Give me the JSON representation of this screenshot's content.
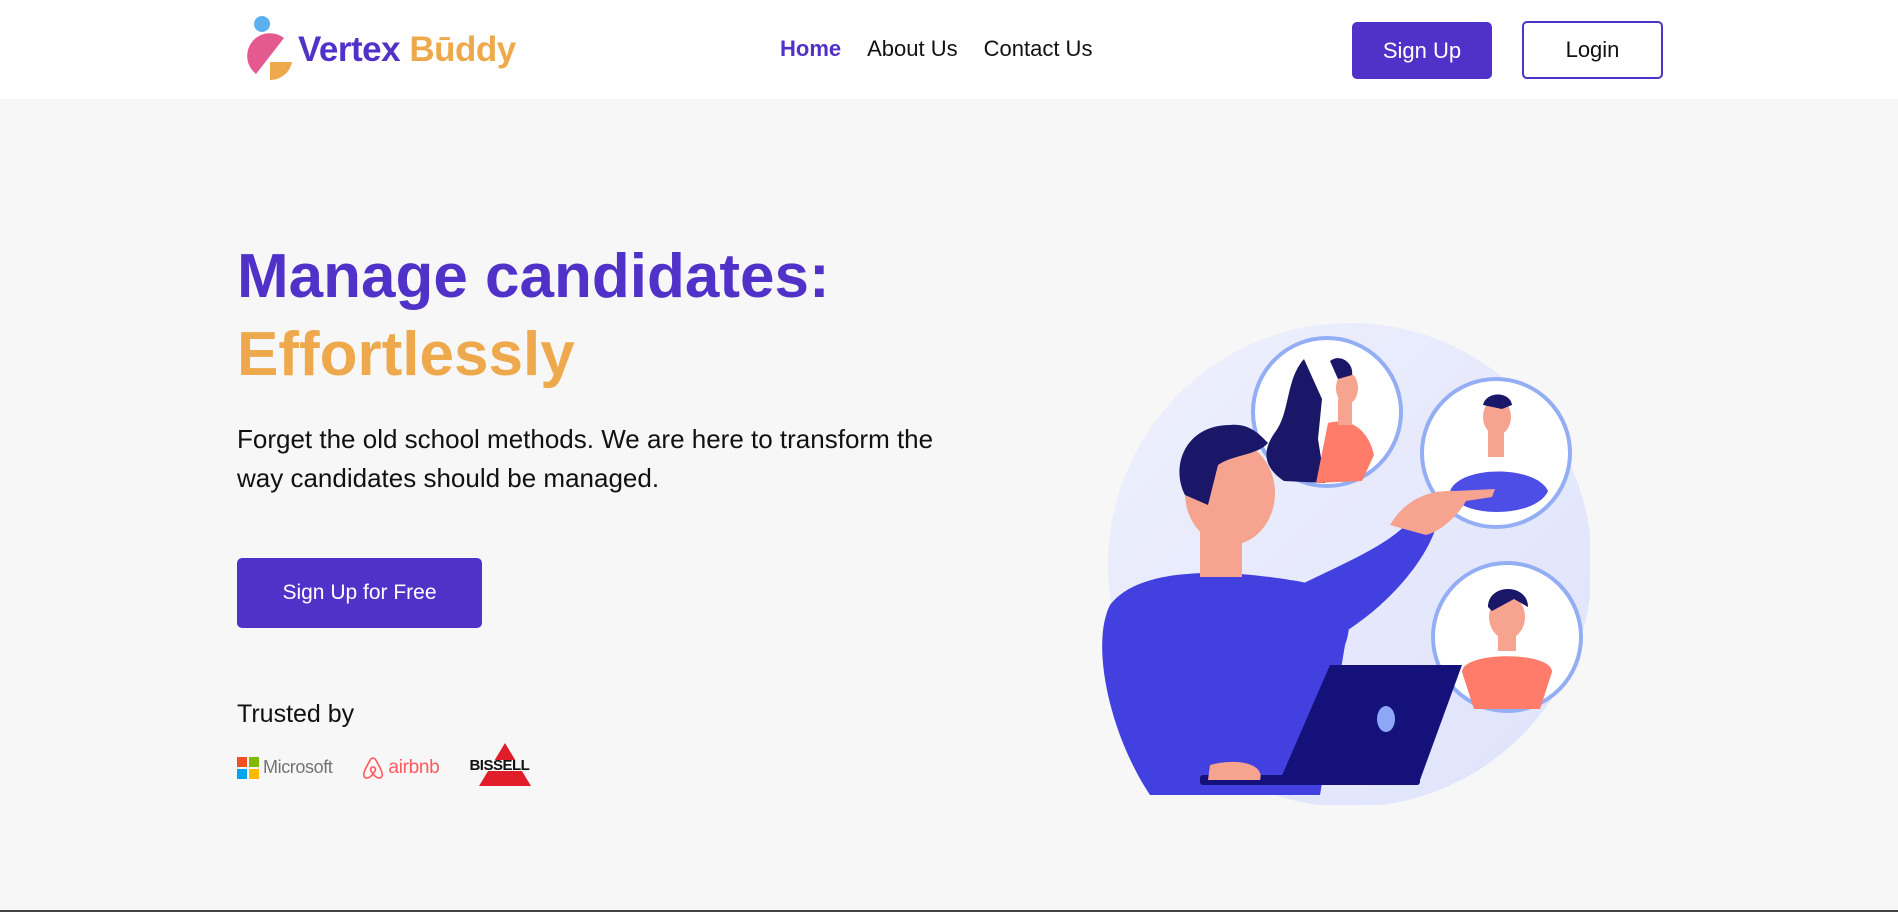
{
  "header": {
    "logo": {
      "word1": "Vertex",
      "word2": "Būddy"
    },
    "nav": [
      {
        "label": "Home",
        "active": true
      },
      {
        "label": "About Us",
        "active": false
      },
      {
        "label": "Contact Us",
        "active": false
      }
    ],
    "signup_label": "Sign Up",
    "login_label": "Login"
  },
  "hero": {
    "title_line1": "Manage candidates:",
    "title_line2": "Effortlessly",
    "subtitle": "Forget the old school methods. We are here to transform the way candidates should be managed.",
    "cta_label": "Sign Up for Free",
    "trusted_label": "Trusted by",
    "brands": [
      "Microsoft",
      "airbnb",
      "BISSELL"
    ]
  },
  "colors": {
    "primary": "#5032c8",
    "accent": "#eda94b",
    "background": "#f7f7f7",
    "header_bg": "#ffffff",
    "airbnb": "#ff5a5f",
    "bissell_red": "#e11d2a"
  },
  "icons": {
    "logo_mark": "vertex-buddy-logo-icon",
    "microsoft": "microsoft-logo-icon",
    "airbnb": "airbnb-logo-icon",
    "bissell": "bissell-logo-icon",
    "illustration": "manager-pointing-at-candidates-illustration"
  }
}
